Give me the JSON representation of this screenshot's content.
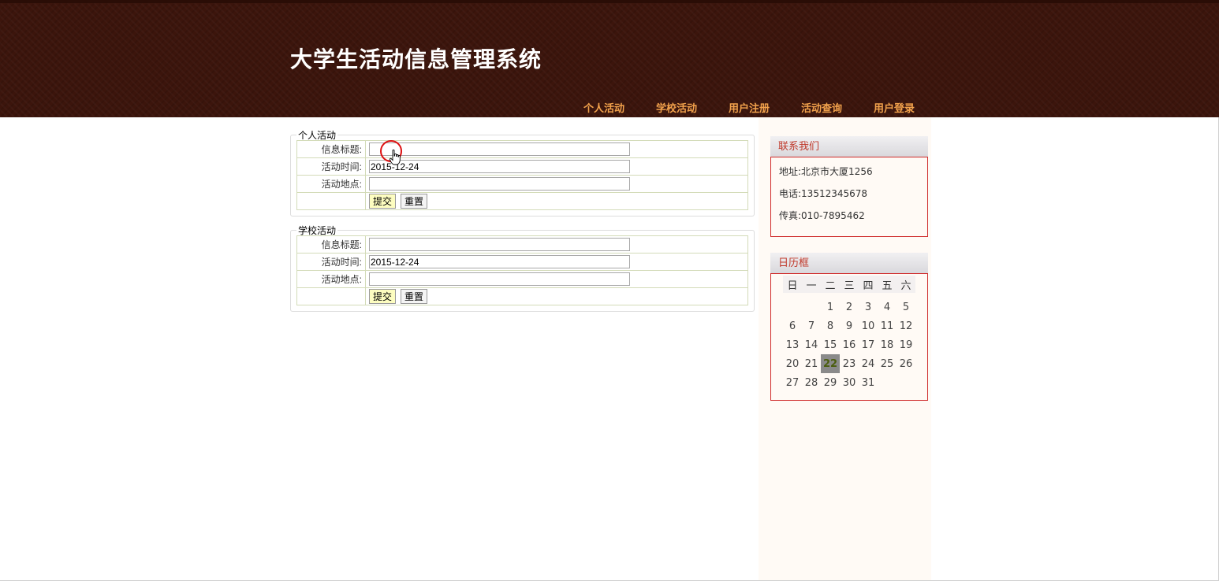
{
  "site": {
    "title": "大学生活动信息管理系统"
  },
  "nav": [
    {
      "label": "个人活动"
    },
    {
      "label": "学校活动"
    },
    {
      "label": "用户注册"
    },
    {
      "label": "活动查询"
    },
    {
      "label": "用户登录"
    }
  ],
  "personal_form": {
    "legend": "个人活动",
    "title_label": "信息标题:",
    "title_value": "",
    "time_label": "活动时间:",
    "time_value": "2015-12-24",
    "place_label": "活动地点:",
    "place_value": "",
    "submit_label": "提交",
    "reset_label": "重置"
  },
  "school_form": {
    "legend": "学校活动",
    "title_label": "信息标题:",
    "title_value": "",
    "time_label": "活动时间:",
    "time_value": "2015-12-24",
    "place_label": "活动地点:",
    "place_value": "",
    "submit_label": "提交",
    "reset_label": "重置"
  },
  "contact": {
    "title": "联系我们",
    "address": "地址:北京市大厦1256",
    "phone": "电话:13512345678",
    "fax": "传真:010-7895462"
  },
  "calendar": {
    "title": "日历框",
    "weekdays": [
      "日",
      "一",
      "二",
      "三",
      "四",
      "五",
      "六"
    ],
    "weeks": [
      [
        "",
        "",
        "1",
        "2",
        "3",
        "4",
        "5"
      ],
      [
        "6",
        "7",
        "8",
        "9",
        "10",
        "11",
        "12"
      ],
      [
        "13",
        "14",
        "15",
        "16",
        "17",
        "18",
        "19"
      ],
      [
        "20",
        "21",
        "22",
        "23",
        "24",
        "25",
        "26"
      ],
      [
        "27",
        "28",
        "29",
        "30",
        "31",
        "",
        ""
      ]
    ],
    "today": "22"
  },
  "colors": {
    "header_bg": "#3c150c",
    "nav_text": "#f2a24c",
    "box_title": "#c0392b",
    "box_border": "#cf2a2a"
  }
}
